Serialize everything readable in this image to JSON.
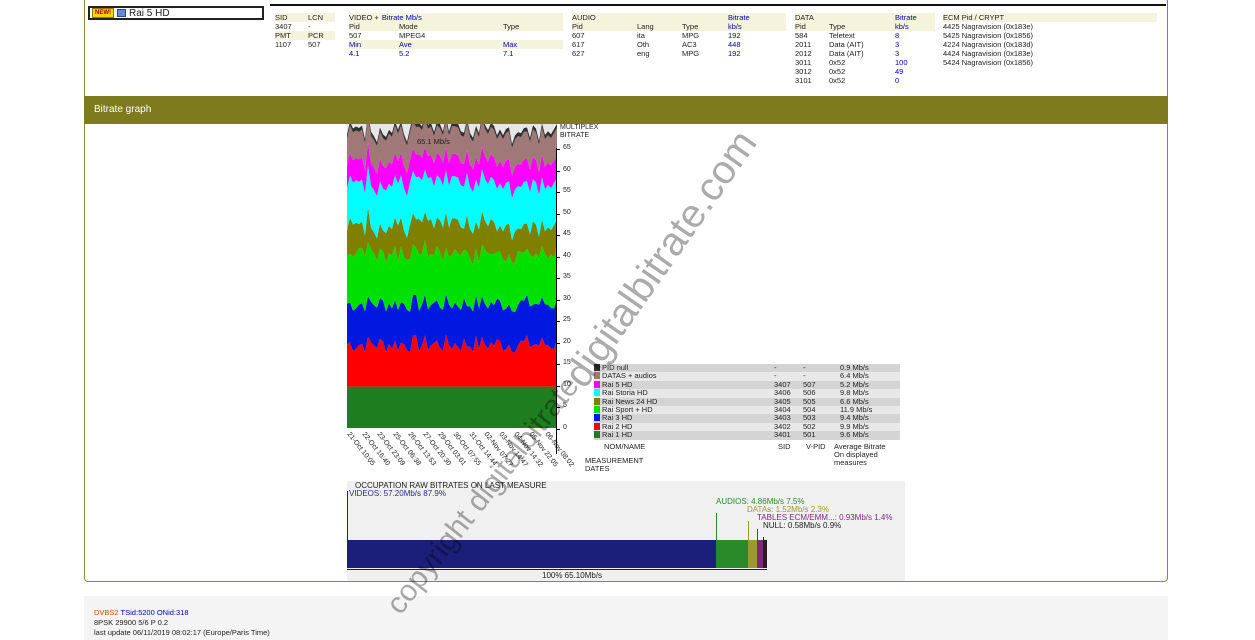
{
  "channel": {
    "badge": "NEW!",
    "name": "Rai 5 HD"
  },
  "sid_block": {
    "header": [
      "SID",
      "LCN"
    ],
    "row1": [
      "3407",
      "-"
    ],
    "header2": [
      "PMT",
      "PCR"
    ],
    "row2": [
      "1107",
      "507"
    ]
  },
  "video": {
    "title": "VIDEO + ",
    "title_link": "Bitrate Mb/s",
    "cols": [
      "Pid",
      "Mode",
      "Type"
    ],
    "row": [
      "507",
      "MPEG4",
      ""
    ],
    "stat_cols": [
      "Min",
      "Ave",
      "Max"
    ],
    "stat_vals": [
      "4.1",
      "5.2",
      "7.1"
    ]
  },
  "audio": {
    "title": "AUDIO",
    "title_right": "Bitrate",
    "cols": [
      "Pid",
      "Lang",
      "Type",
      "kb/s"
    ],
    "rows": [
      [
        "607",
        "ita",
        "MPG",
        "192"
      ],
      [
        "617",
        "Oth",
        "AC3",
        "448"
      ],
      [
        "627",
        "eng",
        "MPG",
        "192"
      ]
    ]
  },
  "data_block": {
    "title": "DATA",
    "title_right": "Bitrate",
    "cols": [
      "Pid",
      "Type",
      "kb/s"
    ],
    "rows": [
      [
        "584",
        "Teletext",
        "8"
      ],
      [
        "2011",
        "Data (AIT)",
        "3"
      ],
      [
        "2012",
        "Data (AIT)",
        "3"
      ],
      [
        "3011",
        "0x52",
        "100"
      ],
      [
        "3012",
        "0x52",
        "49"
      ],
      [
        "3101",
        "0x52",
        "0"
      ]
    ]
  },
  "ecm": {
    "title": "ECM Pid / CRYPT",
    "rows": [
      "4425 Nagravision (0x183e)",
      "5425 Nagravision (0x1856)",
      "4224 Nagravision (0x183d)",
      "4424 Nagravision (0x183e)",
      "5424 Nagravision (0x1856)"
    ]
  },
  "section_title": "Bitrate graph",
  "chart_data": {
    "type": "area",
    "title": "",
    "ylabel": "MULTIPLEX BITRATE",
    "peak_label": "65.1 Mb/s",
    "ylim": [
      0,
      65
    ],
    "yticks": [
      "65",
      "60",
      "55",
      "50",
      "45",
      "40",
      "35",
      "30",
      "25",
      "20",
      "15",
      "10",
      "5",
      "0"
    ],
    "x": [
      "21-Oct 10:05",
      "22-Oct 16:40",
      "23-Oct 23:09",
      "25-Oct 06:38",
      "26-Oct 13:53",
      "27-Oct 20:30",
      "29-Oct 03:01",
      "30-Oct 07:55",
      "31-Oct 14:44",
      "02-Nov 07:27",
      "03-Nov 14:47",
      "04-Nov 14:32",
      "05-Nov 22:05",
      "06-Nov 08:02"
    ],
    "series": [
      {
        "name": "Rai 1 HD",
        "color": "#1e7d1e",
        "value": 9.6
      },
      {
        "name": "Rai 2 HD",
        "color": "#ff0000",
        "value": 9.9
      },
      {
        "name": "Rai 3 HD",
        "color": "#0018e0",
        "value": 9.4
      },
      {
        "name": "Rai Sport + HD",
        "color": "#00e000",
        "value": 11.9
      },
      {
        "name": "Rai News 24 HD",
        "color": "#808000",
        "value": 6.6
      },
      {
        "name": "Rai Storia HD",
        "color": "#00ffff",
        "value": 9.8
      },
      {
        "name": "Rai 5 HD",
        "color": "#ff00ff",
        "value": 5.2
      },
      {
        "name": "DATAS + audios",
        "color": "#a07878",
        "value": 6.4
      },
      {
        "name": "PID null",
        "color": "#303030",
        "value": 0.9
      }
    ]
  },
  "legend": {
    "rows": [
      {
        "name": "PID null",
        "sid": "-",
        "vpid": "-",
        "rate": "0.9 Mb/s",
        "color": "#303030"
      },
      {
        "name": "DATAS + audios",
        "sid": "-",
        "vpid": "-",
        "rate": "6.4 Mb/s",
        "color": "#a07878"
      },
      {
        "name": "Rai 5 HD",
        "sid": "3407",
        "vpid": "507",
        "rate": "5.2 Mb/s",
        "color": "#ff00ff"
      },
      {
        "name": "Rai Storia HD",
        "sid": "3406",
        "vpid": "506",
        "rate": "9.8 Mb/s",
        "color": "#00ffff"
      },
      {
        "name": "Rai News 24 HD",
        "sid": "3405",
        "vpid": "505",
        "rate": "6.6 Mb/s",
        "color": "#808000"
      },
      {
        "name": "Rai Sport + HD",
        "sid": "3404",
        "vpid": "504",
        "rate": "11.9 Mb/s",
        "color": "#00e000"
      },
      {
        "name": "Rai 3 HD",
        "sid": "3403",
        "vpid": "503",
        "rate": "9.4 Mb/s",
        "color": "#0018e0"
      },
      {
        "name": "Rai 2 HD",
        "sid": "3402",
        "vpid": "502",
        "rate": "9.9 Mb/s",
        "color": "#ff0000"
      },
      {
        "name": "Rai 1 HD",
        "sid": "3401",
        "vpid": "501",
        "rate": "9.6 Mb/s",
        "color": "#1e7d1e"
      }
    ],
    "col_name": "NOM/NAME",
    "col_sid": "SID",
    "col_vpid": "V-PID",
    "col_rate": "Average Bitrate On displayed measures",
    "dates_label": "MEASUREMENT DATES"
  },
  "occupation": {
    "title": "OCCUPATION RAW BITRATES ON LAST MEASURE",
    "videos": "VIDEOS: 57.20Mb/s  87.9%",
    "audios": "AUDIOS: 4.86Mb/s  7.5%",
    "datas": "DATAs: 1.52Mb/s  2.3%",
    "tables": "TABLES ECM/EMM...: 0.93Mb/s  1.4%",
    "null": "NULL: 0.58Mb/s  0.9%",
    "total": "100%  65.10Mb/s",
    "shares": [
      87.9,
      7.5,
      2.3,
      1.4,
      0.9
    ],
    "colors": [
      "#1c1f7a",
      "#2a8a2a",
      "#9a9a30",
      "#7a2a7a",
      "#222222"
    ]
  },
  "footer": {
    "dvb": "DVBS2",
    "ids": " TSid:5200 ONid:318",
    "line2": "8PSK 29900 5/6 P 0.2",
    "line3": "last update 06/11/2019 08:02:17 (Europe/Paris Time)"
  },
  "watermark": [
    "digitalbitrate.com",
    "copyright digitalbitrate"
  ]
}
